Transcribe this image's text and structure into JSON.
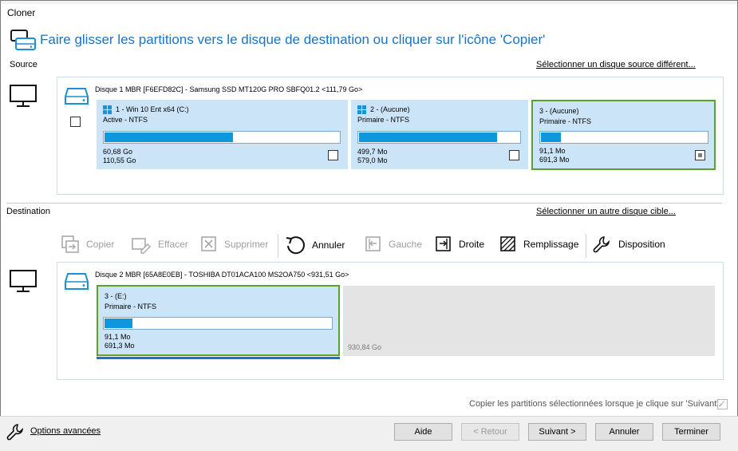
{
  "window": {
    "title": "Cloner"
  },
  "header": {
    "text": "Faire glisser les partitions vers le disque de destination ou cliquer sur l'icône  'Copier'"
  },
  "source": {
    "label": "Source",
    "change_link": "Sélectionner un disque source différent...",
    "disk_title": "Disque 1 MBR [F6EFD82C] - Samsung SSD MT120G PRO SBFQ01.2  <111,79 Go>",
    "partitions": [
      {
        "title": "1 - Win 10 Ent x64 (C:)",
        "type": "Active - NTFS",
        "used": "60,68 Go",
        "total": "110,55 Go",
        "fill": 0.55,
        "checked": false
      },
      {
        "title": "2 -  (Aucune)",
        "type": "Primaire - NTFS",
        "used": "499,7 Mo",
        "total": "579,0 Mo",
        "fill": 0.86,
        "checked": false
      },
      {
        "title": "3 -  (Aucune)",
        "type": "Primaire - NTFS",
        "used": "91,1 Mo",
        "total": "691,3 Mo",
        "fill": 0.13,
        "checked": true
      }
    ]
  },
  "destination": {
    "label": "Destination",
    "change_link": "Sélectionner un autre disque cible...",
    "disk_title": "Disque 2 MBR [65A8E0EB] - TOSHIBA DT01ACA100 MS2OA750  <931,51 Go>",
    "partition": {
      "title": "3 -  (E:)",
      "type": "Primaire - NTFS",
      "used": "91,1 Mo",
      "total": "691,3 Mo",
      "fill": 0.13
    },
    "unallocated": "930,84 Go"
  },
  "toolbar": {
    "copy": "Copier",
    "erase": "Effacer",
    "delete": "Supprimer",
    "undo": "Annuler",
    "left": "Gauche",
    "right": "Droite",
    "fill": "Remplissage",
    "layout": "Disposition"
  },
  "copy_note": "Copier les partitions sélectionnées lorsque je clique sur 'Suivant'.",
  "footer": {
    "advanced": "Options avancées",
    "help": "Aide",
    "back": "< Retour",
    "next": "Suivant >",
    "cancel": "Annuler",
    "finish": "Terminer"
  },
  "colors": {
    "accent": "#1a73c4",
    "partition_bg": "#cce4f7",
    "bar_fill": "#0e97dd",
    "selection": "#5ba12d"
  }
}
